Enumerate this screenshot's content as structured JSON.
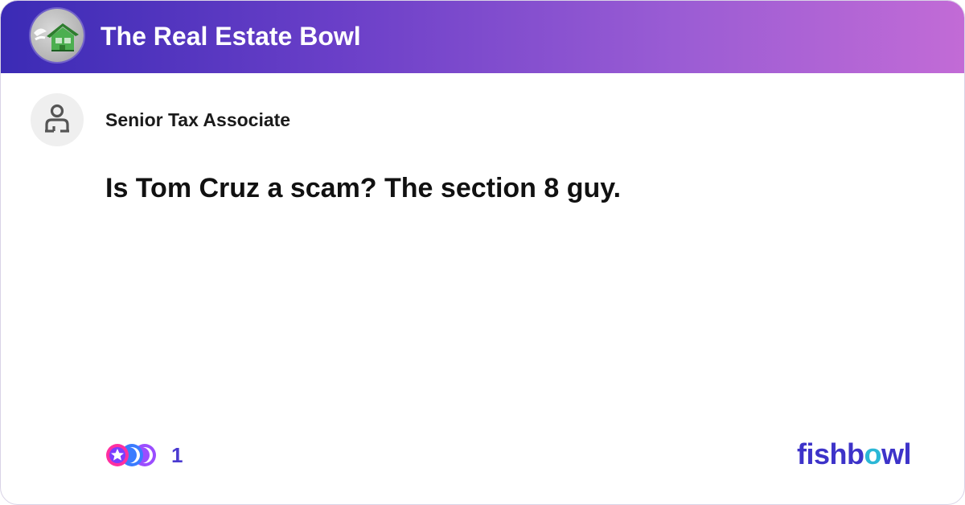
{
  "header": {
    "title": "The Real Estate Bowl",
    "logo_icon": "house-bowl-logo"
  },
  "post": {
    "author": "Senior Tax Associate",
    "avatar_icon": "anonymous-user-icon",
    "title": "Is Tom Cruz a scam? The section 8 guy."
  },
  "footer": {
    "reaction_icon": "reaction-emojis-icon",
    "reaction_count": "1",
    "brand_part1": "fishb",
    "brand_o": "o",
    "brand_part2": "wl"
  },
  "colors": {
    "header_gradient_start": "#3b2bb5",
    "header_gradient_end": "#c26bd6",
    "brand": "#3d33c9",
    "brand_accent": "#2bb7d6"
  }
}
